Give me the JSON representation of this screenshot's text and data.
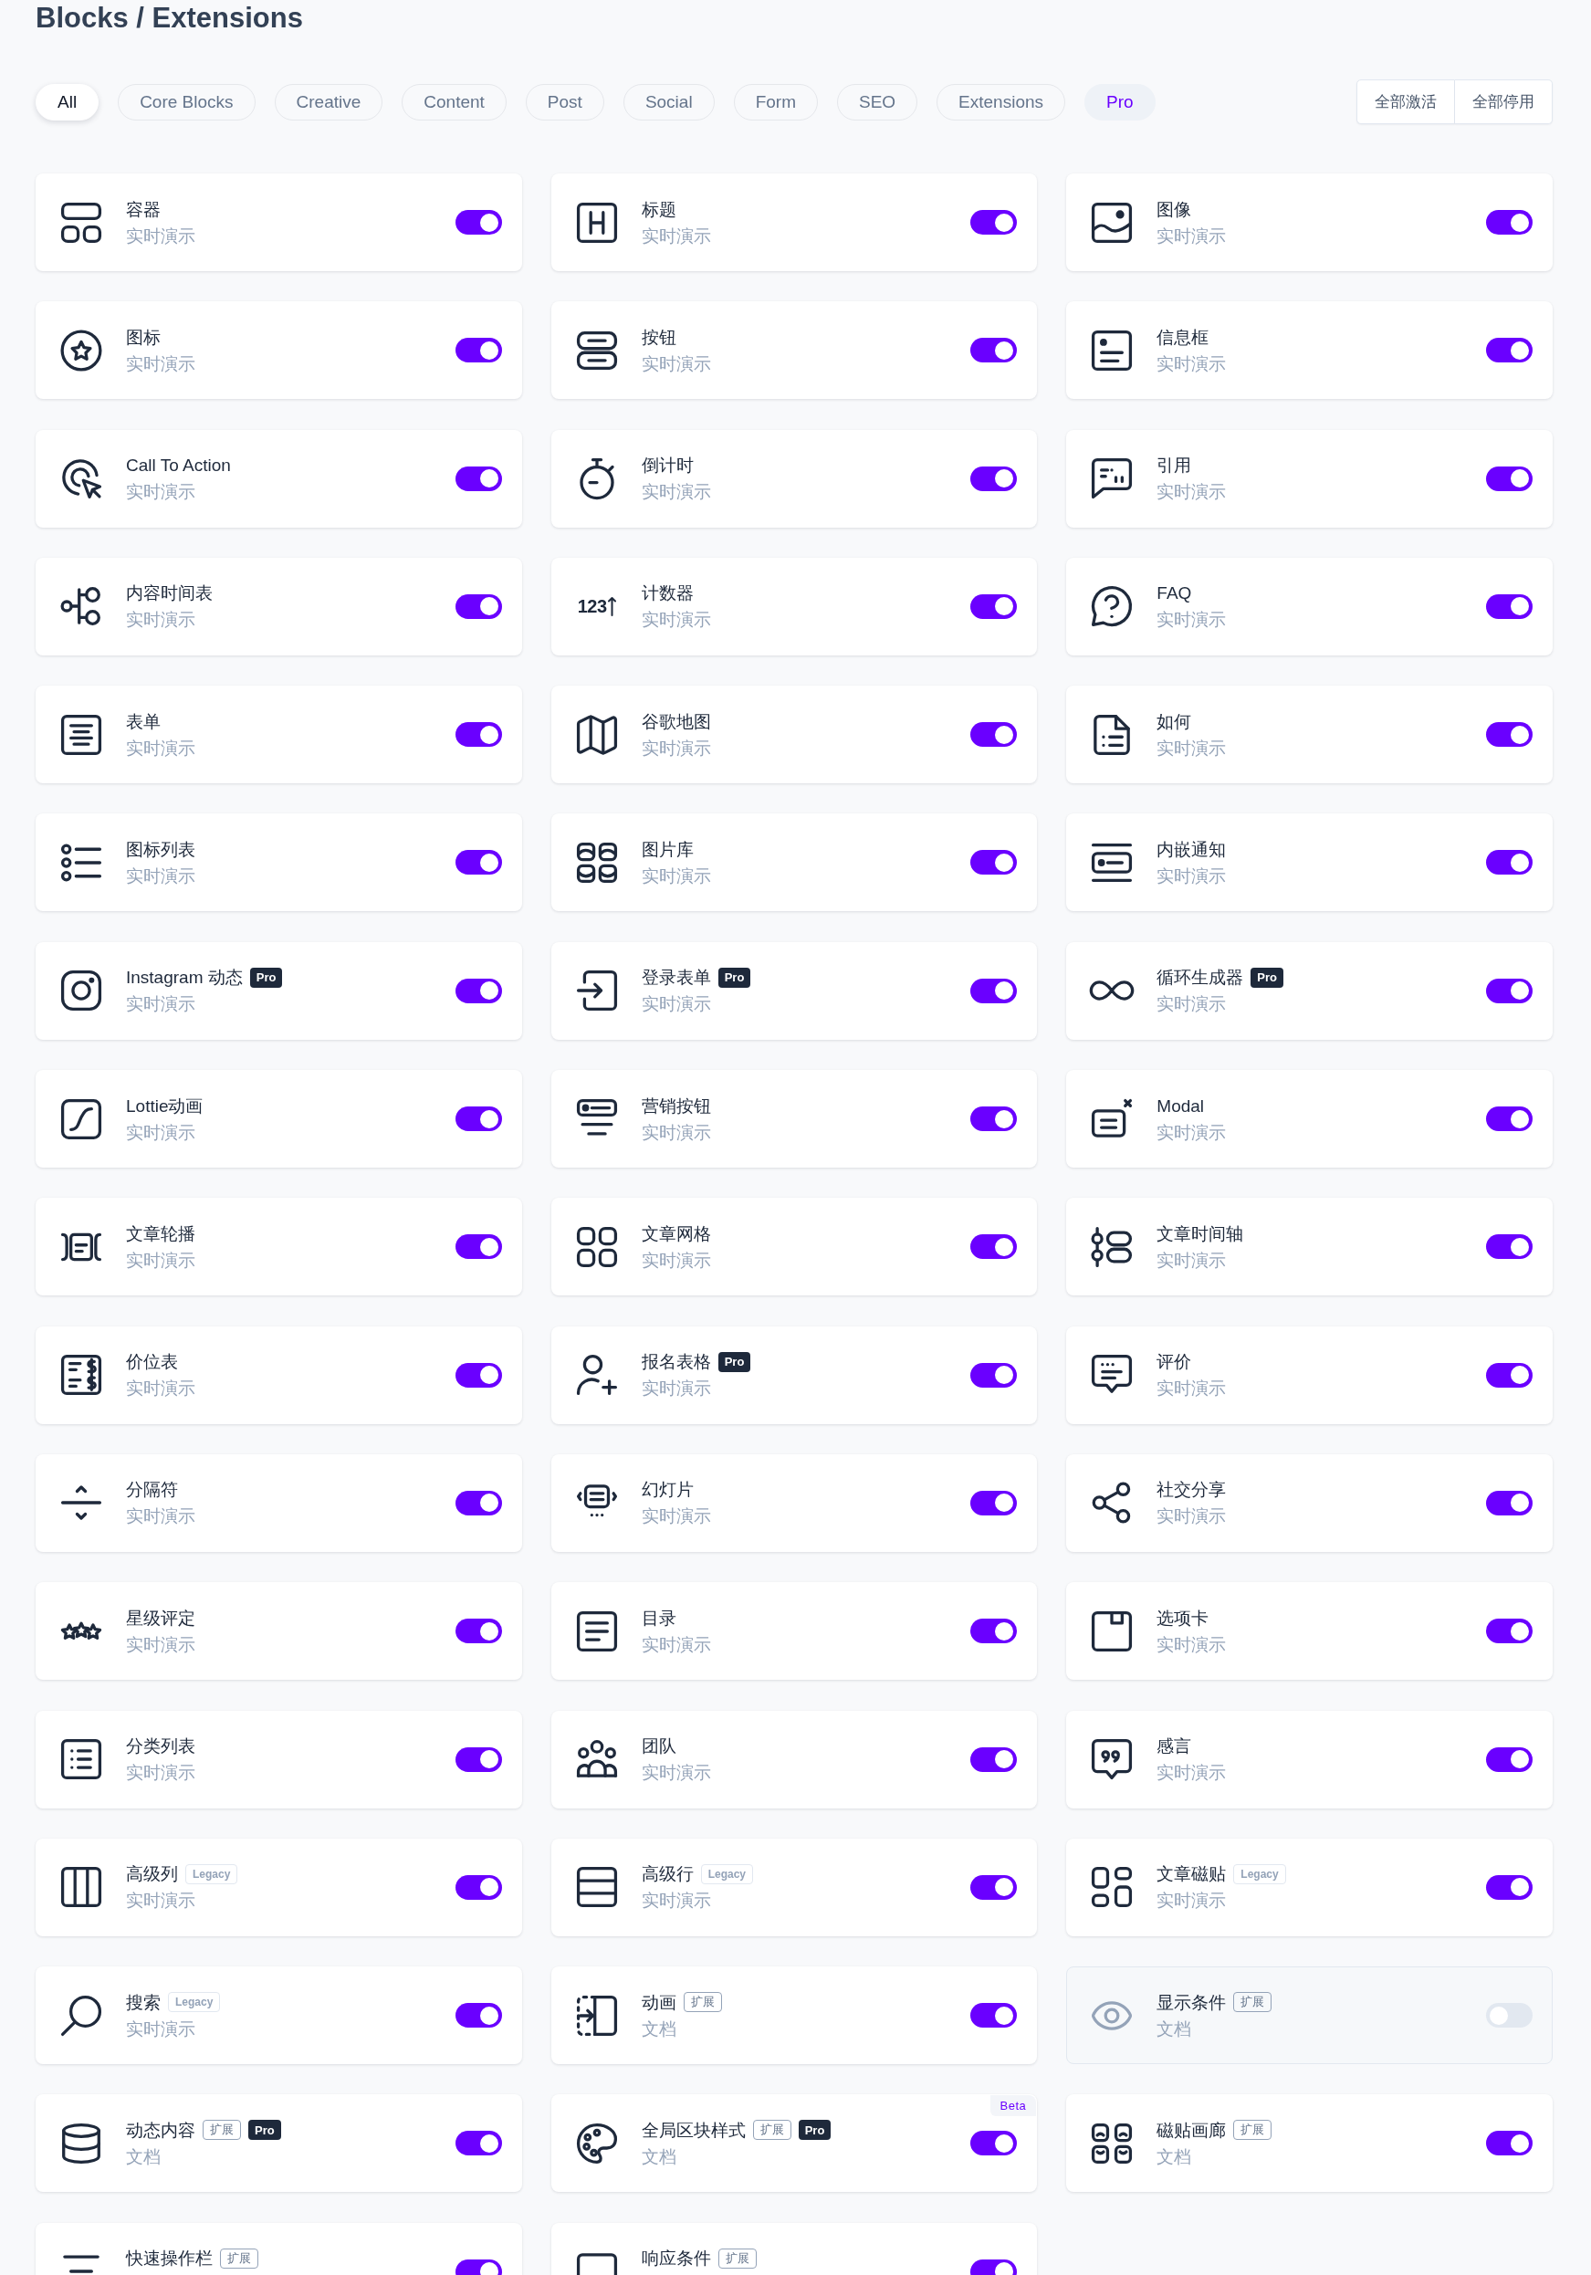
{
  "page": {
    "title": "Blocks / Extensions"
  },
  "filters": [
    {
      "label": "All",
      "selected": true,
      "kind": "category"
    },
    {
      "label": "Core Blocks",
      "selected": false,
      "kind": "category"
    },
    {
      "label": "Creative",
      "selected": false,
      "kind": "category"
    },
    {
      "label": "Content",
      "selected": false,
      "kind": "category"
    },
    {
      "label": "Post",
      "selected": false,
      "kind": "category"
    },
    {
      "label": "Social",
      "selected": false,
      "kind": "category"
    },
    {
      "label": "Form",
      "selected": false,
      "kind": "category"
    },
    {
      "label": "SEO",
      "selected": false,
      "kind": "category"
    },
    {
      "label": "Extensions",
      "selected": false,
      "kind": "category"
    },
    {
      "label": "Pro",
      "selected": false,
      "kind": "pro"
    }
  ],
  "bulk_actions": [
    "全部激活",
    "全部停用"
  ],
  "blocks": [
    {
      "name": "容器",
      "subtitle": "实时演示",
      "enabled": true
    },
    {
      "name": "标题",
      "subtitle": "实时演示",
      "enabled": true
    },
    {
      "name": "图像",
      "subtitle": "实时演示",
      "enabled": true
    },
    {
      "name": "图标",
      "subtitle": "实时演示",
      "enabled": true
    },
    {
      "name": "按钮",
      "subtitle": "实时演示",
      "enabled": true
    },
    {
      "name": "信息框",
      "subtitle": "实时演示",
      "enabled": true
    },
    {
      "name": "Call To Action",
      "subtitle": "实时演示",
      "enabled": true
    },
    {
      "name": "倒计时",
      "subtitle": "实时演示",
      "enabled": true
    },
    {
      "name": "引用",
      "subtitle": "实时演示",
      "enabled": true
    },
    {
      "name": "内容时间表",
      "subtitle": "实时演示",
      "enabled": true
    },
    {
      "name": "计数器",
      "subtitle": "实时演示",
      "enabled": true,
      "icon_text": "123"
    },
    {
      "name": "FAQ",
      "subtitle": "实时演示",
      "enabled": true
    },
    {
      "name": "表单",
      "subtitle": "实时演示",
      "enabled": true
    },
    {
      "name": "谷歌地图",
      "subtitle": "实时演示",
      "enabled": true
    },
    {
      "name": "如何",
      "subtitle": "实时演示",
      "enabled": true
    },
    {
      "name": "图标列表",
      "subtitle": "实时演示",
      "enabled": true
    },
    {
      "name": "图片库",
      "subtitle": "实时演示",
      "enabled": true
    },
    {
      "name": "内嵌通知",
      "subtitle": "实时演示",
      "enabled": true
    },
    {
      "name": "Instagram 动态",
      "subtitle": "实时演示",
      "enabled": true,
      "badges": [
        {
          "kind": "pro",
          "text": "Pro"
        }
      ]
    },
    {
      "name": "登录表单",
      "subtitle": "实时演示",
      "enabled": true,
      "badges": [
        {
          "kind": "pro",
          "text": "Pro"
        }
      ]
    },
    {
      "name": "循环生成器",
      "subtitle": "实时演示",
      "enabled": true,
      "badges": [
        {
          "kind": "pro",
          "text": "Pro"
        }
      ]
    },
    {
      "name": "Lottie动画",
      "subtitle": "实时演示",
      "enabled": true
    },
    {
      "name": "营销按钮",
      "subtitle": "实时演示",
      "enabled": true
    },
    {
      "name": "Modal",
      "subtitle": "实时演示",
      "enabled": true
    },
    {
      "name": "文章轮播",
      "subtitle": "实时演示",
      "enabled": true
    },
    {
      "name": "文章网格",
      "subtitle": "实时演示",
      "enabled": true
    },
    {
      "name": "文章时间轴",
      "subtitle": "实时演示",
      "enabled": true
    },
    {
      "name": "价位表",
      "subtitle": "实时演示",
      "enabled": true
    },
    {
      "name": "报名表格",
      "subtitle": "实时演示",
      "enabled": true,
      "badges": [
        {
          "kind": "pro",
          "text": "Pro"
        }
      ]
    },
    {
      "name": "评价",
      "subtitle": "实时演示",
      "enabled": true
    },
    {
      "name": "分隔符",
      "subtitle": "实时演示",
      "enabled": true
    },
    {
      "name": "幻灯片",
      "subtitle": "实时演示",
      "enabled": true
    },
    {
      "name": "社交分享",
      "subtitle": "实时演示",
      "enabled": true
    },
    {
      "name": "星级评定",
      "subtitle": "实时演示",
      "enabled": true
    },
    {
      "name": "目录",
      "subtitle": "实时演示",
      "enabled": true
    },
    {
      "name": "选项卡",
      "subtitle": "实时演示",
      "enabled": true
    },
    {
      "name": "分类列表",
      "subtitle": "实时演示",
      "enabled": true
    },
    {
      "name": "团队",
      "subtitle": "实时演示",
      "enabled": true
    },
    {
      "name": "感言",
      "subtitle": "实时演示",
      "enabled": true
    },
    {
      "name": "高级列",
      "subtitle": "实时演示",
      "enabled": true,
      "badges": [
        {
          "kind": "legacy",
          "text": "Legacy"
        }
      ]
    },
    {
      "name": "高级行",
      "subtitle": "实时演示",
      "enabled": true,
      "badges": [
        {
          "kind": "legacy",
          "text": "Legacy"
        }
      ]
    },
    {
      "name": "文章磁贴",
      "subtitle": "实时演示",
      "enabled": true,
      "badges": [
        {
          "kind": "legacy",
          "text": "Legacy"
        }
      ]
    },
    {
      "name": "搜索",
      "subtitle": "实时演示",
      "enabled": true,
      "badges": [
        {
          "kind": "legacy",
          "text": "Legacy"
        }
      ]
    },
    {
      "name": "动画",
      "subtitle": "文档",
      "enabled": true,
      "badges": [
        {
          "kind": "extension",
          "text": "扩展"
        }
      ]
    },
    {
      "name": "显示条件",
      "subtitle": "文档",
      "enabled": false,
      "badges": [
        {
          "kind": "extension",
          "text": "扩展"
        }
      ]
    },
    {
      "name": "动态内容",
      "subtitle": "文档",
      "enabled": true,
      "badges": [
        {
          "kind": "extension",
          "text": "扩展"
        },
        {
          "kind": "pro",
          "text": "Pro"
        }
      ]
    },
    {
      "name": "全局区块样式",
      "subtitle": "文档",
      "enabled": true,
      "corner_tag": "Beta",
      "badges": [
        {
          "kind": "extension",
          "text": "扩展"
        },
        {
          "kind": "pro",
          "text": "Pro"
        }
      ]
    },
    {
      "name": "磁贴画廊",
      "subtitle": "文档",
      "enabled": true,
      "badges": [
        {
          "kind": "extension",
          "text": "扩展"
        }
      ]
    },
    {
      "name": "快速操作栏",
      "enabled": true,
      "badges": [
        {
          "kind": "extension",
          "text": "扩展"
        }
      ]
    },
    {
      "name": "响应条件",
      "enabled": true,
      "badges": [
        {
          "kind": "extension",
          "text": "扩展"
        }
      ]
    }
  ]
}
